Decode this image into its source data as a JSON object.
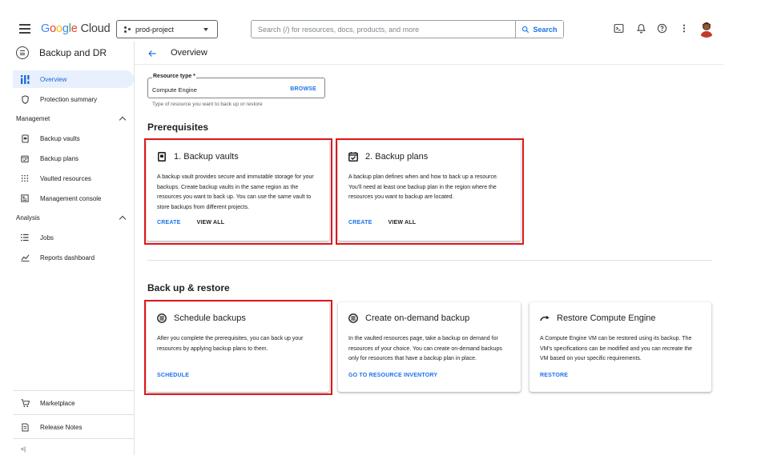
{
  "header": {
    "logo_parts": [
      "G",
      "o",
      "o",
      "g",
      "l",
      "e"
    ],
    "logo_cloud": "Cloud",
    "project": "prod-project",
    "search_placeholder": "Search (/) for resources, docs, products, and more",
    "search_button": "Search",
    "icons": [
      "terminal-icon",
      "bell-icon",
      "help-icon",
      "more-vert-icon"
    ]
  },
  "sidebar": {
    "title": "Backup and DR",
    "items": [
      {
        "label": "Overview",
        "icon": "dashboard-icon",
        "active": true
      },
      {
        "label": "Protection summary",
        "icon": "shield-icon"
      }
    ],
    "sections": [
      {
        "label": "Managemet",
        "items": [
          {
            "label": "Backup vaults",
            "icon": "vault-icon"
          },
          {
            "label": "Backup plans",
            "icon": "calendar-check-icon"
          },
          {
            "label": "Vaulted resources",
            "icon": "grid-icon"
          },
          {
            "label": "Management console",
            "icon": "console-icon"
          }
        ]
      },
      {
        "label": "Analysis",
        "items": [
          {
            "label": "Jobs",
            "icon": "list-icon"
          },
          {
            "label": "Reports dashboard",
            "icon": "chart-icon"
          }
        ]
      }
    ],
    "footer": [
      {
        "label": "Marketplace",
        "icon": "cart-icon"
      },
      {
        "label": "Release Notes",
        "icon": "notes-icon"
      }
    ],
    "collapse_glyph": "<|"
  },
  "main": {
    "title": "Overview",
    "resource_type": {
      "label": "Resource type *",
      "value": "Compute Engine",
      "browse": "BROWSE",
      "help": "Type of resource you want to back up or restore"
    },
    "prerequisites": {
      "heading": "Prerequisites",
      "cards": [
        {
          "title": "1. Backup vaults",
          "desc": "A backup vault provides secure and immutable storage for your backups. Create backup vaults in the same region as the resources you want to back up. You can use the same vault to store backups from different projects.",
          "actions": [
            "CREATE",
            "VIEW ALL"
          ]
        },
        {
          "title": "2. Backup plans",
          "desc": "A backup plan defines when and how to back up a resource. You'll need at least one backup plan in the region where the resources you want to backup are located.",
          "actions": [
            "CREATE",
            "VIEW ALL"
          ]
        }
      ]
    },
    "backup_restore": {
      "heading": "Back up & restore",
      "cards": [
        {
          "title": "Schedule backups",
          "desc": "After you complete the prerequisites, you can back up your resources by applying backup plans to them.",
          "actions": [
            "SCHEDULE"
          ]
        },
        {
          "title": "Create on-demand backup",
          "desc": "In the vaulted resources page, take a backup on demand for resources of your choice. You can create on-demand backups only for resources that have a backup plan in place.",
          "actions": [
            "GO TO RESOURCE INVENTORY"
          ]
        },
        {
          "title": "Restore Compute Engine",
          "desc": "A Compute Engine VM can be restored using its backup. The VM's specifications can be modified and you can recreate the VM based on your specific requirements.",
          "actions": [
            "RESTORE"
          ]
        }
      ]
    }
  },
  "colors": {
    "accent": "#1a73e8",
    "active_bg": "#e8f0fe",
    "highlight": "#e0161a"
  }
}
